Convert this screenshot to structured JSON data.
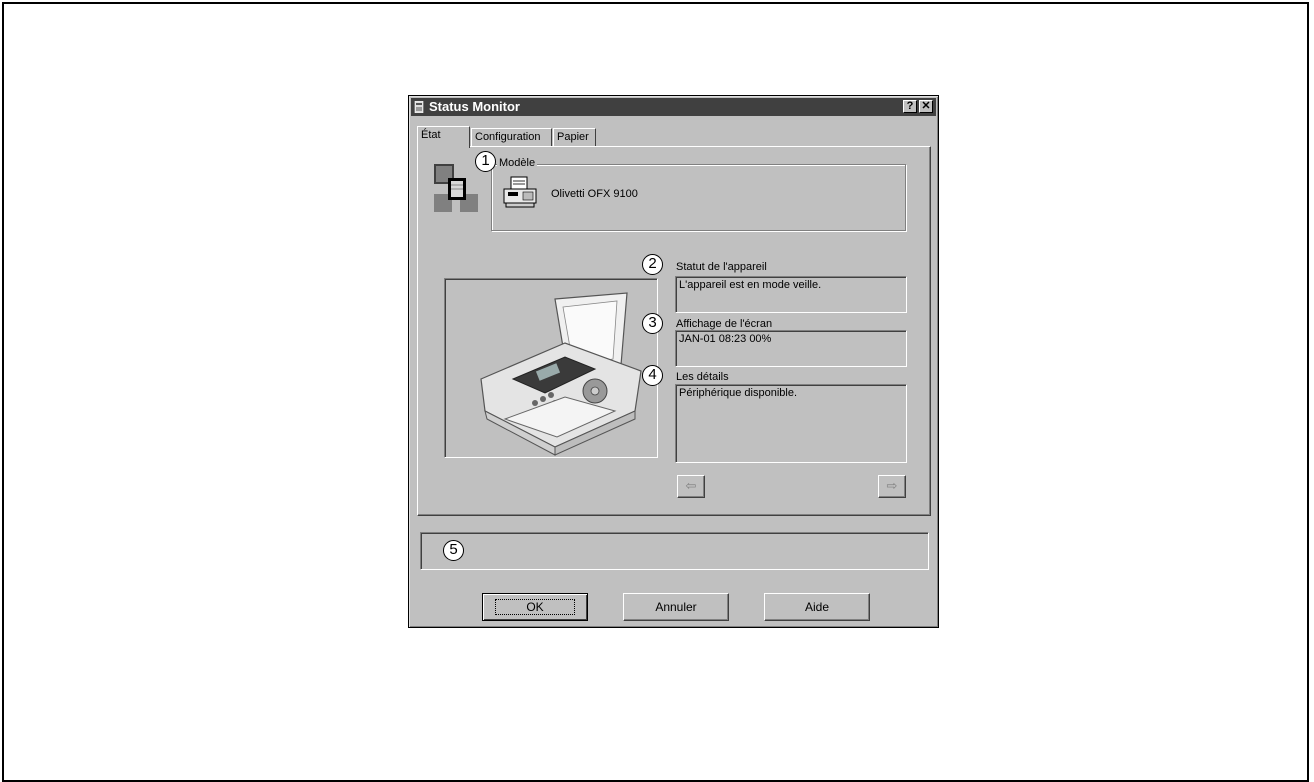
{
  "window": {
    "title": "Status Monitor",
    "help_button": "?",
    "close_button": "✕"
  },
  "tabs": [
    {
      "label": "État"
    },
    {
      "label": "Configuration"
    },
    {
      "label": "Papier"
    }
  ],
  "model": {
    "group_label": "Modèle",
    "name": "Olivetti OFX 9100"
  },
  "device_status": {
    "label": "Statut de l'appareil",
    "value": "L'appareil est en mode veille."
  },
  "screen_display": {
    "label": "Affichage de l'écran",
    "value": "JAN-01 08:23 00%"
  },
  "details": {
    "label": "Les détails",
    "value": "Périphérique disponible."
  },
  "nav": {
    "prev": "⇦",
    "next": "⇨"
  },
  "callouts": [
    "1",
    "2",
    "3",
    "4",
    "5"
  ],
  "buttons": {
    "ok": "OK",
    "cancel": "Annuler",
    "help": "Aide"
  },
  "colors": {
    "titlebar": "#404040",
    "face": "#c0c0c0"
  },
  "icons": [
    "device-network-icon",
    "fax-icon",
    "printer-image"
  ]
}
